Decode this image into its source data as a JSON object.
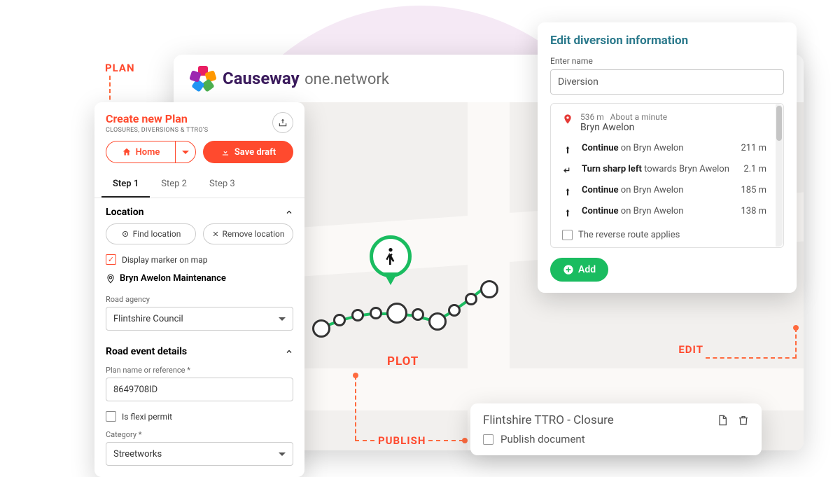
{
  "brand": {
    "main": "Causeway",
    "sub": " one.network"
  },
  "callouts": {
    "plan": "PLAN",
    "plot": "PLOT",
    "edit": "EDIT",
    "publish": "PUBLISH"
  },
  "plan": {
    "title": "Create new Plan",
    "subtitle": "CLOSURES, DIVERSIONS & TTRO'S",
    "home_label": "Home",
    "save_label": "Save draft",
    "tabs": [
      "Step 1",
      "Step 2",
      "Step 3"
    ],
    "active_tab": 0,
    "location": {
      "heading": "Location",
      "find": "Find location",
      "remove": "Remove location",
      "display_marker": "Display marker on map",
      "display_marker_checked": true,
      "name": "Bryn Awelon Maintenance",
      "agency_label": "Road agency",
      "agency_value": "Flintshire Council"
    },
    "event": {
      "heading": "Road event details",
      "plan_name_label": "Plan name or reference *",
      "plan_name_value": "8649708ID",
      "flexi": "Is flexi permit",
      "flexi_checked": false,
      "category_label": "Category *",
      "category_value": "Streetworks"
    }
  },
  "edit": {
    "title": "Edit diversion information",
    "name_label": "Enter name",
    "name_value": "Diversion",
    "route_length": "536 m",
    "route_time": "About a minute",
    "route_name": "Bryn Awelon",
    "directions": [
      {
        "icon": "straight",
        "text_bold": "Continue",
        "text_rest": " on Bryn Awelon",
        "dist": "211 m"
      },
      {
        "icon": "sharp-left",
        "text_bold": "Turn sharp left",
        "text_rest": " towards Bryn Awelon",
        "dist": "2.1 m"
      },
      {
        "icon": "straight",
        "text_bold": "Continue",
        "text_rest": " on Bryn Awelon",
        "dist": "185 m"
      },
      {
        "icon": "straight",
        "text_bold": "Continue",
        "text_rest": " on Bryn Awelon",
        "dist": "138 m"
      }
    ],
    "reverse_label": "The reverse route applies",
    "add_label": "Add"
  },
  "publish": {
    "title": "Flintshire TTRO - Closure",
    "checkbox": "Publish document"
  }
}
